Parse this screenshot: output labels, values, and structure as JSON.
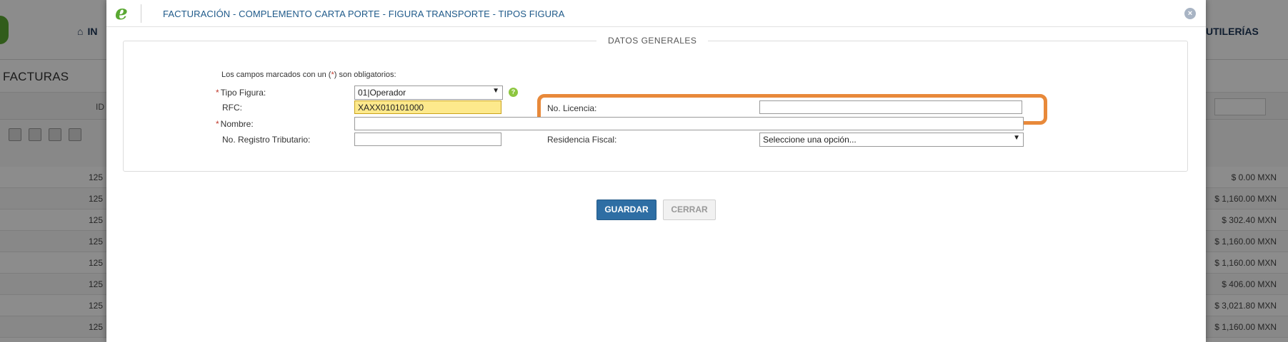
{
  "background": {
    "nav": {
      "home_label": "IN",
      "util_label": "UTILERÍAS"
    },
    "section_title": "FACTURAS",
    "filter_id": "ID",
    "rows": [
      {
        "id": "125",
        "amount": "$ 0.00 MXN"
      },
      {
        "id": "125",
        "amount": "$ 1,160.00 MXN"
      },
      {
        "id": "125",
        "amount": "$ 302.40 MXN"
      },
      {
        "id": "125",
        "amount": "$ 1,160.00 MXN"
      },
      {
        "id": "125",
        "amount": "$ 1,160.00 MXN"
      },
      {
        "id": "125",
        "amount": "$ 406.00 MXN"
      },
      {
        "id": "125",
        "amount": "$ 3,021.80 MXN"
      },
      {
        "id": "125",
        "amount": "$ 1,160.00 MXN"
      }
    ]
  },
  "modal": {
    "brand_glyph": "e",
    "title": "FACTURACIÓN - COMPLEMENTO CARTA PORTE - FIGURA TRANSPORTE - TIPOS FIGURA",
    "close_glyph": "×",
    "legend": "DATOS GENERALES",
    "note_prefix": "Los campos marcados con un (",
    "note_ast": "*",
    "note_suffix": ") son obligatorios:",
    "required_mark": "*",
    "fields": {
      "tipo_figura": {
        "label": "Tipo Figura:",
        "value": "01|Operador"
      },
      "rfc": {
        "label": "RFC:",
        "value": "XAXX010101000"
      },
      "nombre": {
        "label": "Nombre:",
        "value": ""
      },
      "no_registro": {
        "label": "No. Registro Tributario:",
        "value": ""
      },
      "no_licencia": {
        "label": "No. Licencia:",
        "value": ""
      },
      "residencia": {
        "label": "Residencia Fiscal:",
        "value": "Seleccione una opción..."
      }
    },
    "help_glyph": "?",
    "buttons": {
      "save": "GUARDAR",
      "close": "CERRAR"
    },
    "colors": {
      "accent": "#2e6ea4",
      "highlight": "#e8893a",
      "brand": "#5aa832"
    }
  }
}
